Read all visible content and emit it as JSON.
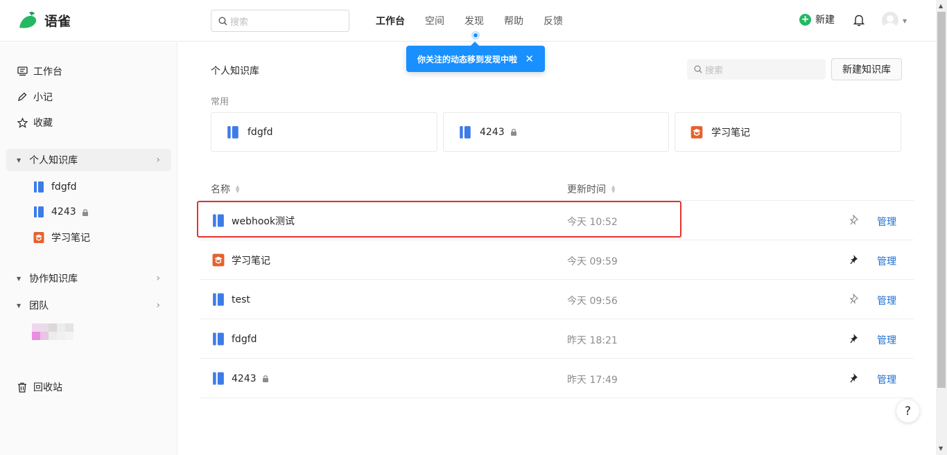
{
  "app": {
    "name": "语雀"
  },
  "header": {
    "search_placeholder": "搜索",
    "nav": [
      "工作台",
      "空间",
      "发现",
      "帮助",
      "反馈"
    ],
    "new_label": "新建",
    "tooltip": "你关注的动态移到发现中啦"
  },
  "sidebar": {
    "items": [
      {
        "label": "工作台",
        "icon": "workbench-icon"
      },
      {
        "label": "小记",
        "icon": "pen-icon"
      },
      {
        "label": "收藏",
        "icon": "star-icon"
      }
    ],
    "personal_group": "个人知识库",
    "personal_libs": [
      {
        "label": "fdgfd",
        "icon": "book-blue-icon",
        "locked": false
      },
      {
        "label": "4243",
        "icon": "book-blue-icon",
        "locked": true
      },
      {
        "label": "学习笔记",
        "icon": "book-orange-icon",
        "locked": false
      }
    ],
    "collab_group": "协作知识库",
    "team_group": "团队",
    "trash": "回收站"
  },
  "main": {
    "title": "个人知识库",
    "search_placeholder": "搜索",
    "new_button": "新建知识库",
    "common_label": "常用",
    "common_cards": [
      {
        "label": "fdgfd",
        "icon": "book-blue-icon",
        "locked": false
      },
      {
        "label": "4243",
        "icon": "book-blue-icon",
        "locked": true
      },
      {
        "label": "学习笔记",
        "icon": "book-orange-icon",
        "locked": false
      }
    ],
    "columns": {
      "name": "名称",
      "updated": "更新时间"
    },
    "rows": [
      {
        "name": "webhook测试",
        "time": "今天 10:52",
        "icon": "book-blue-icon",
        "locked": false,
        "pinned": false,
        "action": "管理"
      },
      {
        "name": "学习笔记",
        "time": "今天 09:59",
        "icon": "book-orange-icon",
        "locked": false,
        "pinned": true,
        "action": "管理"
      },
      {
        "name": "test",
        "time": "今天 09:56",
        "icon": "book-blue-icon",
        "locked": false,
        "pinned": false,
        "action": "管理"
      },
      {
        "name": "fdgfd",
        "time": "昨天 18:21",
        "icon": "book-blue-icon",
        "locked": false,
        "pinned": true,
        "action": "管理"
      },
      {
        "name": "4243",
        "time": "昨天 17:49",
        "icon": "book-blue-icon",
        "locked": true,
        "pinned": true,
        "action": "管理"
      }
    ]
  },
  "help_label": "?",
  "colors": {
    "accent": "#1890ff",
    "brand_green": "#25b864",
    "book_blue": "#3d7be8",
    "book_orange": "#e5622e",
    "highlight": "#e8302d"
  }
}
